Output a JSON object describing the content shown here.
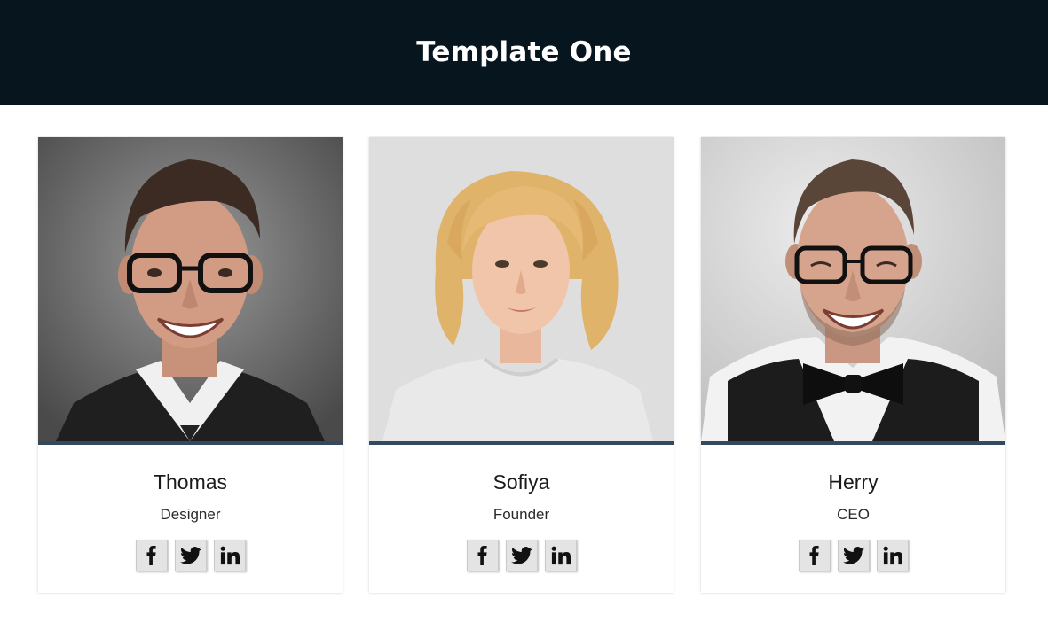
{
  "header": {
    "title": "Template One",
    "background": "#06151e"
  },
  "theme": {
    "accent_bar": "#34485e",
    "social_button_bg": "#e4e4e4"
  },
  "cards": [
    {
      "name": "Thomas",
      "role": "Designer",
      "photo": "portrait-man-glasses-suit",
      "socials": [
        "facebook-icon",
        "twitter-icon",
        "linkedin-icon"
      ]
    },
    {
      "name": "Sofiya",
      "role": "Founder",
      "photo": "portrait-woman-blonde-curly",
      "socials": [
        "facebook-icon",
        "twitter-icon",
        "linkedin-icon"
      ]
    },
    {
      "name": "Herry",
      "role": "CEO",
      "photo": "portrait-man-glasses-bowtie",
      "socials": [
        "facebook-icon",
        "twitter-icon",
        "linkedin-icon"
      ]
    }
  ]
}
